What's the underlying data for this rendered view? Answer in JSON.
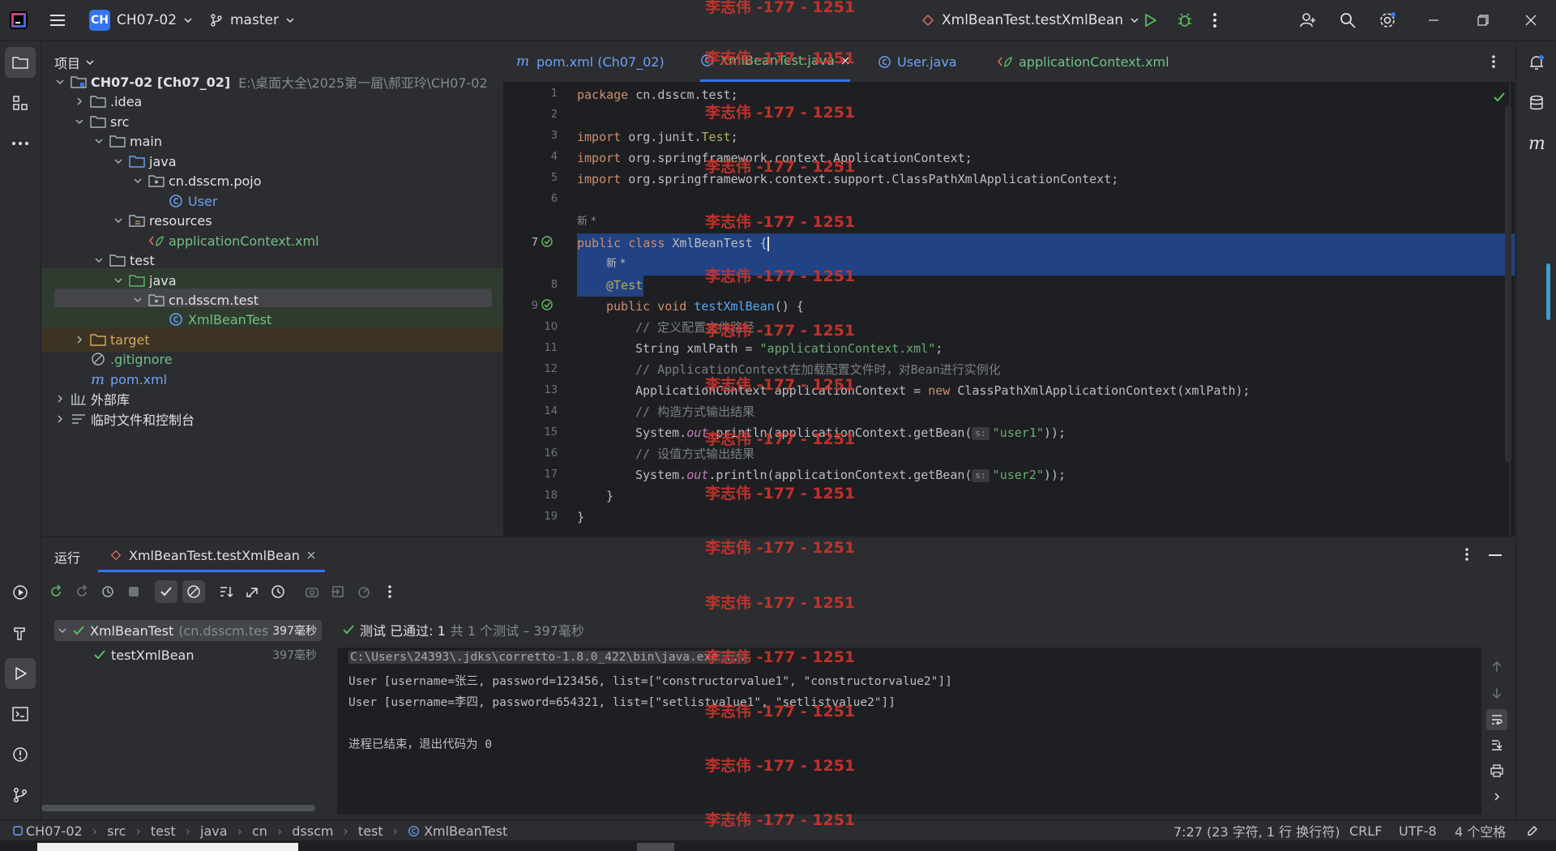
{
  "titlebar": {
    "project_badge": "CH",
    "project_name": "CH07-02",
    "branch": "master",
    "run_config": "XmlBeanTest.testXmlBean"
  },
  "project_panel": {
    "title": "项目",
    "tree": [
      {
        "label": "CH07-02 [Ch07_02]",
        "path": "E:\\桌面大全\\2025第一届\\郝亚玲\\CH07-02"
      },
      {
        "label": ".idea"
      },
      {
        "label": "src"
      },
      {
        "label": "main"
      },
      {
        "label": "java"
      },
      {
        "label": "cn.dsscm.pojo"
      },
      {
        "label": "User"
      },
      {
        "label": "resources"
      },
      {
        "label": "applicationContext.xml"
      },
      {
        "label": "test"
      },
      {
        "label": "java"
      },
      {
        "label": "cn.dsscm.test"
      },
      {
        "label": "XmlBeanTest"
      },
      {
        "label": "target"
      },
      {
        "label": ".gitignore"
      },
      {
        "label": "pom.xml"
      },
      {
        "label": "外部库"
      },
      {
        "label": "临时文件和控制台"
      }
    ]
  },
  "editor": {
    "tabs": [
      {
        "label": "pom.xml (Ch07_02)"
      },
      {
        "label": "XmlBeanTest.java"
      },
      {
        "label": "User.java"
      },
      {
        "label": "applicationContext.xml"
      }
    ],
    "line_numbers": [
      "1",
      "2",
      "3",
      "4",
      "5",
      "6",
      "7",
      "8",
      "9",
      "10",
      "11",
      "12",
      "13",
      "14",
      "15",
      "16",
      "17",
      "18",
      "19"
    ],
    "code": {
      "l1_kw": "package",
      "l1_rest": " cn.dsscm.test;",
      "l3_kw": "import",
      "l3_a": " org.junit.",
      "l3_ann": "Test",
      "l3_end": ";",
      "l4_kw": "import",
      "l4_rest": " org.springframework.context.ApplicationContext;",
      "l5_kw": "import",
      "l5_rest": " org.springframework.context.support.ClassPathXmlApplicationContext;",
      "author_hint": "新 *",
      "l7_kw": "public class",
      "l7_name": " XmlBeanTest ",
      "l7_brace": "{",
      "author_hint2": "新 *",
      "l8_ann": "@Test",
      "l9_kw": "public void",
      "l9_fn": " testXmlBean",
      "l9_rest": "() {",
      "l10_cmt": "// 定义配置文件路径",
      "l11_a": "String xmlPath = ",
      "l11_str": "\"applicationContext.xml\"",
      "l11_end": ";",
      "l12_cmt": "// ApplicationContext在加载配置文件时，对Bean进行实例化",
      "l13_a": "ApplicationContext applicationContext = ",
      "l13_kw": "new",
      "l13_rest": " ClassPathXmlApplicationContext(xmlPath);",
      "l14_cmt": "// 构造方式输出结果",
      "l15_a": "System.",
      "l15_field": "out",
      "l15_b": ".println(applicationContext.getBean(",
      "l15_hint": "s:",
      "l15_str": "\"user1\"",
      "l15_end": "));",
      "l16_cmt": "// 设值方式输出结果",
      "l17_a": "System.",
      "l17_field": "out",
      "l17_b": ".println(applicationContext.getBean(",
      "l17_hint": "s:",
      "l17_str": "\"user2\"",
      "l17_end": "));",
      "l18": "}",
      "l19": "}"
    }
  },
  "run_panel": {
    "title": "运行",
    "tab": "XmlBeanTest.testXmlBean",
    "tests": [
      {
        "name": "XmlBeanTest",
        "pkg": "(cn.dsscm.test",
        "time": "397毫秒"
      },
      {
        "name": "testXmlBean",
        "time": "397毫秒"
      }
    ],
    "summary_bold": "测试 已通过: 1",
    "summary_rest": "共 1 个测试 – 397毫秒",
    "console": [
      "C:\\Users\\24393\\.jdks\\corretto-1.8.0_422\\bin\\java.exe ...",
      "User [username=张三, password=123456, list=[\"constructorvalue1\", \"constructorvalue2\"]]",
      "User [username=李四, password=654321, list=[\"setlistvalue1\", \"setlistvalue2\"]]",
      "",
      "进程已结束，退出代码为 0"
    ]
  },
  "statusbar": {
    "crumbs": [
      "CH07-02",
      "src",
      "test",
      "java",
      "cn",
      "dsscm",
      "test",
      "XmlBeanTest"
    ],
    "position": "7:27 (23 字符, 1 行 换行符)",
    "line_sep": "CRLF",
    "encoding": "UTF-8",
    "indent": "4 个空格"
  },
  "watermark": "李志伟 -177 - 1251",
  "colors": {
    "accent": "#3574f0",
    "pass": "#5fb865",
    "watermark": "#d0342c"
  }
}
